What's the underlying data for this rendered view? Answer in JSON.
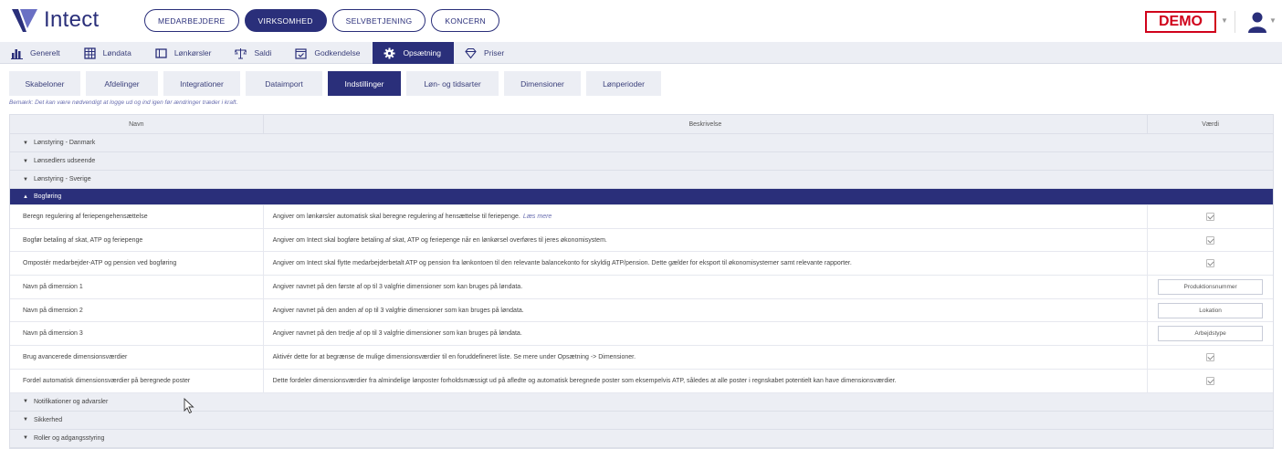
{
  "header": {
    "logo_text": "Intect",
    "nav": [
      "MEDARBEJDERE",
      "VIRKSOMHED",
      "SELVBETJENING",
      "KONCERN"
    ],
    "nav_active": 1,
    "demo_label": "DEMO",
    "brand_color": "#2a2f7a",
    "demo_color": "#d0021b"
  },
  "modules": [
    {
      "label": "Generelt",
      "icon": "bar-chart-icon"
    },
    {
      "label": "Løndata",
      "icon": "grid-icon"
    },
    {
      "label": "Lønkørsler",
      "icon": "window-icon"
    },
    {
      "label": "Saldi",
      "icon": "scale-icon"
    },
    {
      "label": "Godkendelse",
      "icon": "calendar-check-icon"
    },
    {
      "label": "Opsætning",
      "icon": "gear-icon"
    },
    {
      "label": "Priser",
      "icon": "diamond-icon"
    }
  ],
  "modules_active": 5,
  "subtabs": [
    "Skabeloner",
    "Afdelinger",
    "Integrationer",
    "Dataimport",
    "Indstillinger",
    "Løn- og tidsarter",
    "Dimensioner",
    "Lønperioder"
  ],
  "subtabs_active": 4,
  "note": "Bemærk: Det kan være nødvendigt at logge ud og ind igen før ændringer træder i kraft.",
  "table": {
    "headers": [
      "Navn",
      "Beskrivelse",
      "Værdi"
    ],
    "groups_before": [
      "Lønstyring - Danmark",
      "Lønsedlers udseende",
      "Lønstyring - Sverige"
    ],
    "open_group": "Bogføring",
    "rows": [
      {
        "name": "Beregn regulering af feriepengehensættelse",
        "desc": "Angiver om lønkørsler automatisk skal beregne regulering af hensættelse til feriepenge.",
        "link": "Læs mere",
        "type": "check",
        "value": ""
      },
      {
        "name": "Bogfør betaling af skat, ATP og feriepenge",
        "desc": "Angiver om Intect skal bogføre betaling af skat, ATP og feriepenge når en lønkørsel overføres til jeres økonomisystem.",
        "link": "",
        "type": "check",
        "value": ""
      },
      {
        "name": "Ompostér medarbejder-ATP og pension ved bogføring",
        "desc": "Angiver om Intect skal flytte medarbejderbetalt ATP og pension fra lønkontoen til den relevante balancekonto for skyldig ATP/pension. Dette gælder for eksport til økonomisystemer samt relevante rapporter.",
        "link": "",
        "type": "check",
        "value": ""
      },
      {
        "name": "Navn på dimension 1",
        "desc": "Angiver navnet på den første af op til 3 valgfrie dimensioner som kan bruges på løndata.",
        "link": "",
        "type": "text",
        "value": "Produktionsnummer"
      },
      {
        "name": "Navn på dimension 2",
        "desc": "Angiver navnet på den anden af op til 3 valgfrie dimensioner som kan bruges på løndata.",
        "link": "",
        "type": "text",
        "value": "Lokation"
      },
      {
        "name": "Navn på dimension 3",
        "desc": "Angiver navnet på den tredje af op til 3 valgfrie dimensioner som kan bruges på løndata.",
        "link": "",
        "type": "text",
        "value": "Arbejdstype"
      },
      {
        "name": "Brug avancerede dimensionsværdier",
        "desc": "Aktivér dette for at begrænse de mulige dimensionsværdier til en foruddefineret liste. Se mere under Opsætning -> Dimensioner.",
        "link": "",
        "type": "check",
        "value": ""
      },
      {
        "name": "Fordel automatisk dimensionsværdier på beregnede poster",
        "desc": "Dette fordeler dimensionsværdier fra almindelige lønposter forholdsmæssigt ud på afledte og automatisk beregnede poster som eksempelvis ATP, således at alle poster i regnskabet potentielt kan have dimensionsværdier.",
        "link": "",
        "type": "check",
        "value": ""
      }
    ],
    "groups_after": [
      "Notifikationer og advarsler",
      "Sikkerhed",
      "Roller og adgangsstyring"
    ]
  }
}
